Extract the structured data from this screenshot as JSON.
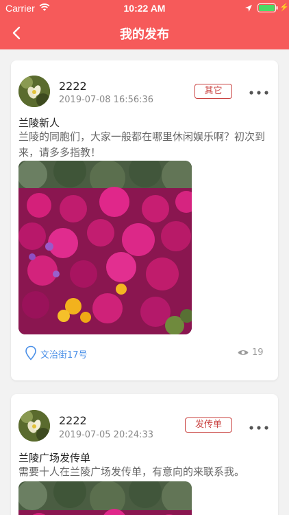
{
  "status_bar": {
    "carrier": "Carrier",
    "time": "10:22 AM"
  },
  "nav": {
    "title": "我的发布"
  },
  "posts": [
    {
      "username": "2222",
      "time": "2019-07-08 16:56:36",
      "tag": "其它",
      "title": "兰陵新人",
      "text": "兰陵的同胞们，大家一般都在哪里休闲娱乐啊？初次到来，请多多指教！",
      "location": "文治街17号",
      "views": "19"
    },
    {
      "username": "2222",
      "time": "2019-07-05 20:24:33",
      "tag": "发传单",
      "title": "兰陵广场发传单",
      "text": "需要十人在兰陵广场发传单，有意向的来联系我。"
    }
  ],
  "colors": {
    "primary": "#f65a5a",
    "tag_border": "#c9413f",
    "location": "#4a8fe7"
  }
}
